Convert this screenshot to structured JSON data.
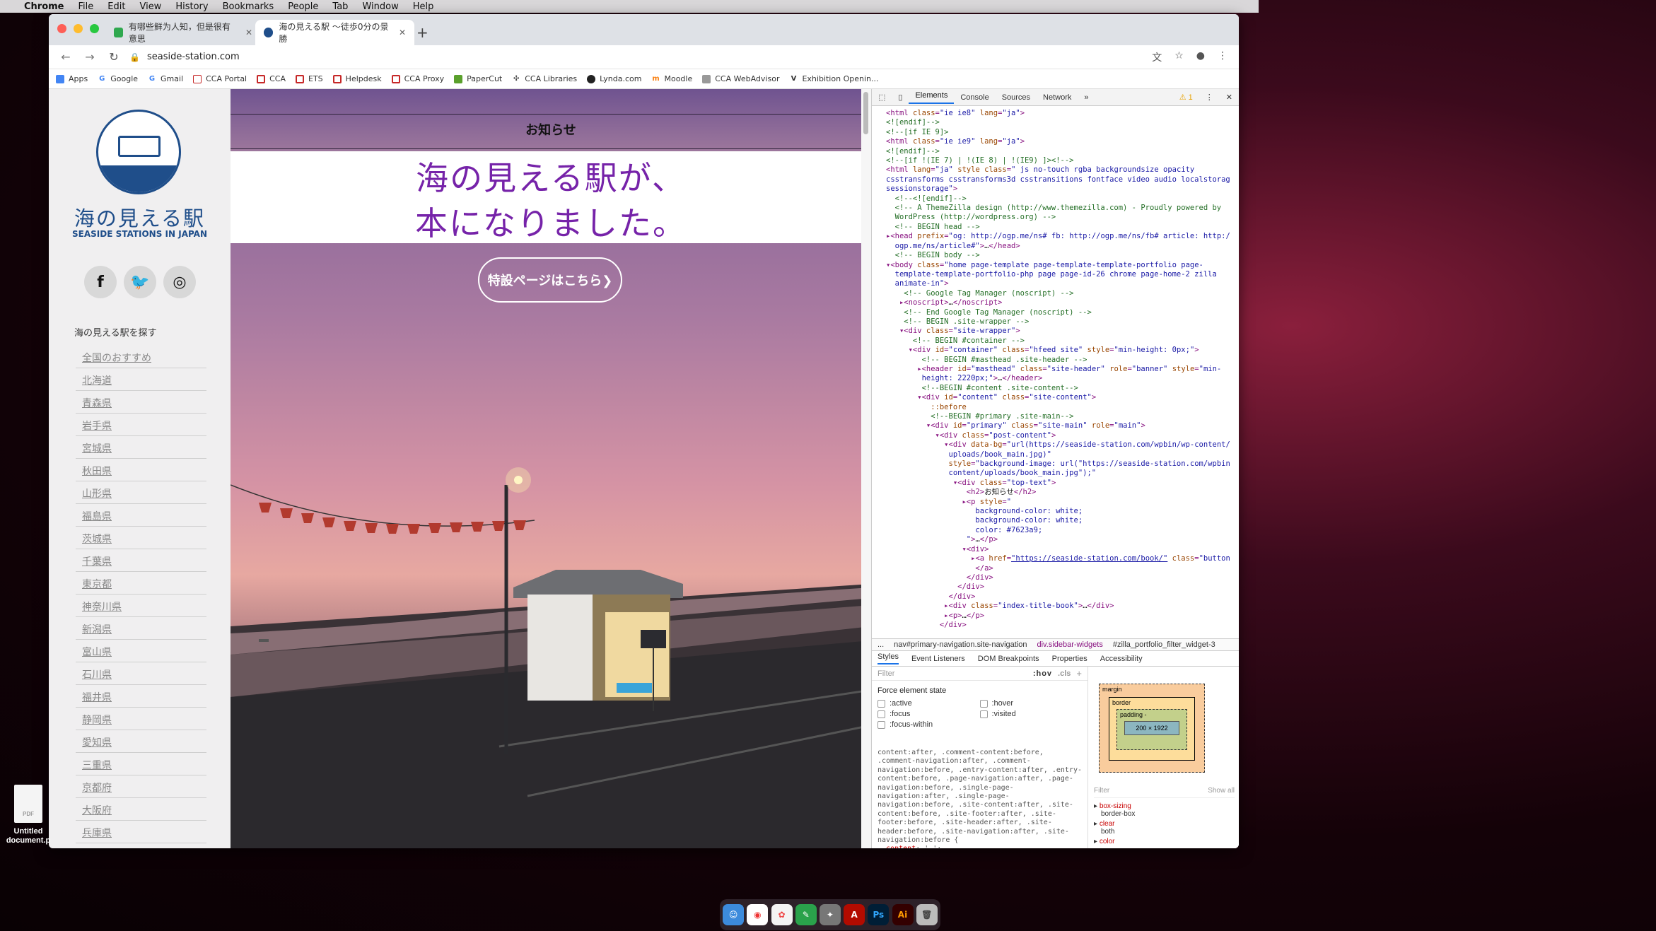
{
  "mac_menu": {
    "apple": "",
    "app": "Chrome",
    "items": [
      "File",
      "Edit",
      "View",
      "History",
      "Bookmarks",
      "People",
      "Tab",
      "Window",
      "Help"
    ]
  },
  "tabs": [
    {
      "title": "有哪些鲜为人知，但是很有意思",
      "active": false
    },
    {
      "title": "海の見える駅 ～徒歩0分の景勝",
      "active": true
    }
  ],
  "address": "seaside-station.com",
  "bookmarks": [
    "Apps",
    "Google",
    "Gmail",
    "CCA Portal",
    "CCA",
    "ETS",
    "Helpdesk",
    "CCA Proxy",
    "PaperCut",
    "CCA Libraries",
    "Lynda.com",
    "Moodle",
    "CCA WebAdvisor",
    "Exhibition Openin..."
  ],
  "site": {
    "logo_jp": "海の見える駅",
    "logo_en": "SEASIDE STATIONS IN JAPAN",
    "side_heading": "海の見える駅を探す",
    "prefectures": [
      "全国のおすすめ",
      "北海道",
      "青森県",
      "岩手県",
      "宮城県",
      "秋田県",
      "山形県",
      "福島県",
      "茨城県",
      "千葉県",
      "東京都",
      "神奈川県",
      "新潟県",
      "富山県",
      "石川県",
      "福井県",
      "静岡県",
      "愛知県",
      "三重県",
      "京都府",
      "大阪府",
      "兵庫県"
    ],
    "notice": "お知らせ",
    "headline_1": "海の見える駅が、",
    "headline_2": "本になりました。",
    "cta": "特設ページはこちら❯"
  },
  "devtools": {
    "tabs": [
      "Elements",
      "Console",
      "Sources",
      "Network",
      "»"
    ],
    "warning": "⚠ 1",
    "breadcrumbs": [
      "...",
      "nav#primary-navigation.site-navigation",
      "div.sidebar-widgets",
      "#zilla_portfolio_filter_widget-3"
    ],
    "subtabs": [
      "Styles",
      "Event Listeners",
      "DOM Breakpoints",
      "Properties",
      "Accessibility"
    ],
    "filter": "Filter",
    "hov": ":hov",
    "cls": ".cls",
    "force_title": "Force element state",
    "states": [
      ":active",
      ":hover",
      ":focus",
      ":visited",
      ":focus-within"
    ],
    "box": {
      "margin": "margin",
      "border": "border",
      "padding": "padding -",
      "content": "200 × 1922"
    },
    "computed_filter": "Filter",
    "show_all": "Show all",
    "computed": [
      {
        "prop": "box-sizing",
        "val": "border-box"
      },
      {
        "prop": "clear",
        "val": "both"
      },
      {
        "prop": "color",
        "val": ""
      }
    ]
  },
  "desktop_file": "Untitled document.p",
  "colors": {
    "accent_purple": "#7623a9",
    "logo_blue": "#1f4e8a"
  }
}
